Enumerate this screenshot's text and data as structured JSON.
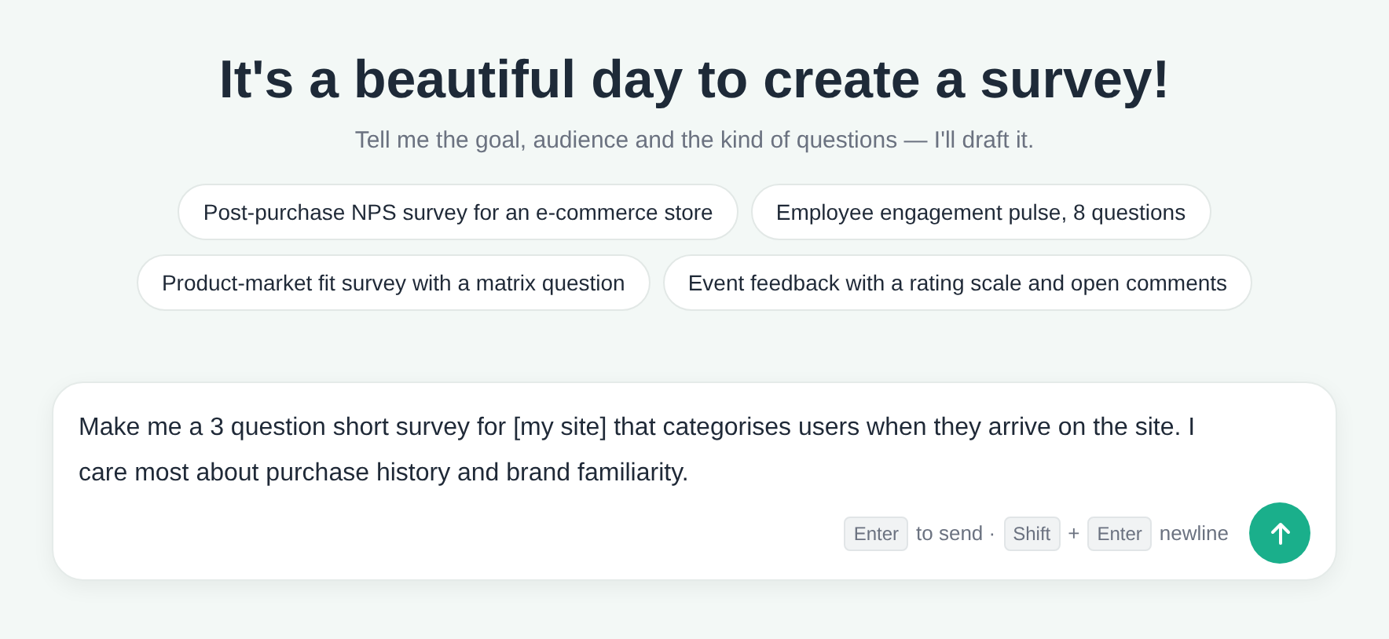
{
  "heading": "It's a beautiful day to create a survey!",
  "subheading": "Tell me the goal, audience and the kind of questions — I'll draft it.",
  "suggestions": [
    [
      "Post-purchase NPS survey for an e-commerce store",
      "Employee engagement pulse, 8 questions"
    ],
    [
      "Product-market fit survey with a matrix question",
      "Event feedback with a rating scale and open comments"
    ]
  ],
  "composer": {
    "value": "Make me a 3 question short survey for [my site] that categorises users when they arrive on the site. I care most about purchase history and brand familiarity.",
    "hint": [
      {
        "kind": "key",
        "text": "Enter"
      },
      {
        "kind": "text",
        "text": "to send ·"
      },
      {
        "kind": "key",
        "text": "Shift"
      },
      {
        "kind": "text",
        "text": "+"
      },
      {
        "kind": "key",
        "text": "Enter"
      },
      {
        "kind": "text",
        "text": "newline"
      }
    ]
  }
}
